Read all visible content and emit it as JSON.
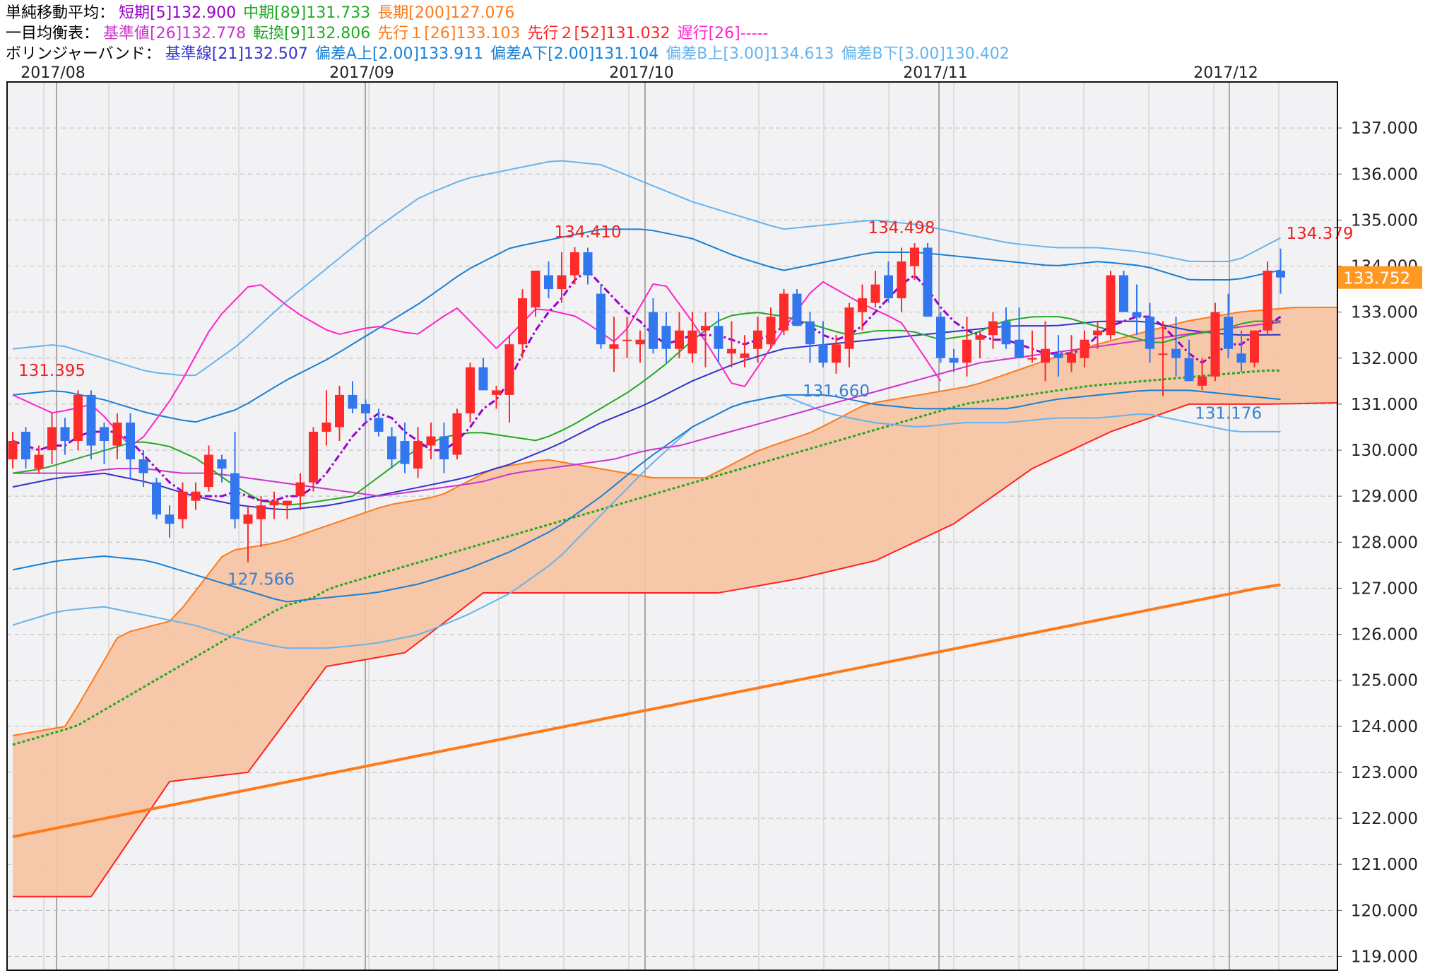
{
  "legend": {
    "sma": {
      "title": "単純移動平均：",
      "short": "短期[5]132.900",
      "mid": "中期[89]131.733",
      "long": "長期[200]127.076"
    },
    "ichimoku": {
      "title": "一目均衡表：",
      "kijun": "基準値[26]132.778",
      "tenkan": "転換[9]132.806",
      "senko1": "先行１[26]133.103",
      "senko2": "先行２[52]131.032",
      "chikou": "遅行[26]-----"
    },
    "bollinger": {
      "title": "ボリンジャーバンド：",
      "base": "基準線[21]132.507",
      "a_up": "偏差A上[2.00]133.911",
      "a_down": "偏差A下[2.00]131.104",
      "b_up": "偏差B上[3.00]134.613",
      "b_down": "偏差B下[3.00]130.402"
    }
  },
  "colors": {
    "sma_short": "#9900cc",
    "sma_mid": "#22aa22",
    "sma_long": "#ff7a1a",
    "kijun": "#cc33cc",
    "tenkan": "#22aa22",
    "senko1": "#ff7a1a",
    "senko2": "#ff2222",
    "chikou": "#ff22cc",
    "bb_base": "#3333cc",
    "bb_a": "#1a7fd4",
    "bb_b": "#66b3ee",
    "cloud": "#f6c4a4",
    "up_candle": "#ff2a2a",
    "down_candle": "#3377ee",
    "price_tag": "#ff9922"
  },
  "chart_data": {
    "type": "candlestick",
    "months": [
      "2017/08",
      "2017/09",
      "2017/10",
      "2017/11",
      "2017/12"
    ],
    "ylim": [
      118.7,
      138.0
    ],
    "y_ticks": [
      "137.000",
      "136.000",
      "135.000",
      "134.000",
      "133.000",
      "132.000",
      "131.000",
      "130.000",
      "129.000",
      "128.000",
      "127.000",
      "126.000",
      "125.000",
      "124.000",
      "123.000",
      "122.000",
      "121.000",
      "120.000",
      "119.000"
    ],
    "current_price": "133.752",
    "annotations": [
      {
        "text": "131.395",
        "value": 131.395,
        "index": 3,
        "kind": "high"
      },
      {
        "text": "127.566",
        "value": 127.566,
        "index": 19,
        "kind": "low"
      },
      {
        "text": "134.410",
        "value": 134.41,
        "index": 44,
        "kind": "high"
      },
      {
        "text": "131.660",
        "value": 131.66,
        "index": 63,
        "kind": "low"
      },
      {
        "text": "134.498",
        "value": 134.498,
        "index": 68,
        "kind": "high"
      },
      {
        "text": "131.176",
        "value": 131.176,
        "index": 93,
        "kind": "low"
      },
      {
        "text": "134.379",
        "value": 134.379,
        "index": 100,
        "kind": "high"
      }
    ],
    "candles": [
      [
        129.8,
        130.4,
        129.6,
        130.2
      ],
      [
        130.4,
        130.5,
        129.6,
        129.8
      ],
      [
        129.6,
        130.1,
        129.5,
        129.9
      ],
      [
        130.0,
        130.8,
        129.7,
        130.5
      ],
      [
        130.5,
        130.7,
        129.9,
        130.2
      ],
      [
        130.2,
        131.3,
        130.0,
        131.2
      ],
      [
        131.2,
        131.3,
        129.8,
        130.1
      ],
      [
        130.5,
        130.6,
        129.7,
        130.2
      ],
      [
        130.1,
        130.8,
        129.8,
        130.6
      ],
      [
        130.6,
        130.8,
        129.4,
        129.8
      ],
      [
        129.8,
        130.0,
        129.2,
        129.5
      ],
      [
        129.3,
        129.4,
        128.5,
        128.6
      ],
      [
        128.6,
        128.8,
        128.1,
        128.4
      ],
      [
        128.5,
        129.3,
        128.3,
        129.1
      ],
      [
        128.9,
        129.3,
        128.7,
        129.1
      ],
      [
        129.2,
        130.1,
        129.1,
        129.9
      ],
      [
        129.8,
        129.9,
        129.3,
        129.6
      ],
      [
        129.5,
        130.4,
        128.3,
        128.5
      ],
      [
        128.4,
        128.8,
        127.566,
        128.6
      ],
      [
        128.5,
        129.0,
        127.9,
        128.8
      ],
      [
        128.8,
        129.1,
        128.5,
        128.9
      ],
      [
        128.8,
        128.9,
        128.5,
        128.9
      ],
      [
        129.0,
        129.5,
        128.7,
        129.3
      ],
      [
        129.3,
        130.5,
        129.1,
        130.4
      ],
      [
        130.4,
        131.3,
        130.1,
        130.6
      ],
      [
        130.5,
        131.4,
        130.2,
        131.2
      ],
      [
        131.2,
        131.5,
        130.8,
        130.9
      ],
      [
        131.0,
        131.1,
        130.6,
        130.8
      ],
      [
        130.7,
        130.9,
        130.3,
        130.4
      ],
      [
        130.3,
        130.5,
        129.6,
        129.8
      ],
      [
        130.2,
        130.6,
        129.5,
        129.7
      ],
      [
        129.6,
        130.5,
        129.4,
        130.2
      ],
      [
        130.1,
        130.6,
        129.8,
        130.3
      ],
      [
        130.3,
        130.6,
        129.5,
        129.8
      ],
      [
        129.9,
        130.9,
        129.8,
        130.8
      ],
      [
        130.8,
        131.9,
        130.6,
        131.8
      ],
      [
        131.8,
        132.0,
        131.3,
        131.3
      ],
      [
        131.2,
        131.4,
        130.9,
        131.3
      ],
      [
        131.2,
        132.5,
        130.6,
        132.3
      ],
      [
        132.3,
        133.5,
        132.0,
        133.3
      ],
      [
        133.1,
        133.9,
        132.9,
        133.9
      ],
      [
        133.8,
        134.1,
        133.3,
        133.5
      ],
      [
        133.5,
        134.3,
        133.2,
        133.8
      ],
      [
        133.8,
        134.41,
        133.6,
        134.3
      ],
      [
        134.3,
        134.4,
        133.6,
        133.8
      ],
      [
        133.4,
        133.6,
        132.2,
        132.3
      ],
      [
        132.2,
        132.9,
        131.7,
        132.3
      ],
      [
        132.4,
        132.9,
        132.0,
        132.4
      ],
      [
        132.3,
        132.6,
        131.9,
        132.4
      ],
      [
        133.0,
        133.3,
        132.1,
        132.2
      ],
      [
        132.7,
        133.0,
        131.9,
        132.2
      ],
      [
        132.2,
        133.0,
        132.0,
        132.6
      ],
      [
        132.1,
        133.0,
        131.9,
        132.6
      ],
      [
        132.6,
        133.0,
        131.8,
        132.7
      ],
      [
        132.7,
        133.0,
        131.9,
        132.2
      ],
      [
        132.1,
        132.8,
        131.8,
        132.2
      ],
      [
        132.0,
        132.5,
        131.8,
        132.1
      ],
      [
        132.2,
        132.9,
        131.9,
        132.6
      ],
      [
        132.3,
        133.1,
        132.2,
        132.9
      ],
      [
        132.6,
        133.5,
        132.5,
        133.4
      ],
      [
        133.4,
        133.5,
        132.7,
        132.7
      ],
      [
        132.8,
        133.0,
        131.9,
        132.3
      ],
      [
        132.3,
        132.8,
        131.8,
        131.9
      ],
      [
        131.9,
        132.5,
        131.66,
        132.3
      ],
      [
        132.2,
        133.2,
        131.8,
        133.1
      ],
      [
        133.0,
        133.6,
        132.6,
        133.3
      ],
      [
        133.2,
        133.9,
        133.1,
        133.6
      ],
      [
        133.8,
        134.1,
        133.2,
        133.3
      ],
      [
        133.3,
        134.4,
        133.0,
        134.1
      ],
      [
        134.0,
        134.498,
        133.7,
        134.4
      ],
      [
        134.4,
        134.5,
        132.9,
        132.9
      ],
      [
        132.9,
        133.0,
        131.9,
        132.0
      ],
      [
        132.0,
        132.2,
        131.7,
        131.9
      ],
      [
        131.9,
        132.9,
        131.6,
        132.4
      ],
      [
        132.4,
        132.6,
        132.0,
        132.5
      ],
      [
        132.5,
        133.0,
        132.2,
        132.8
      ],
      [
        132.8,
        133.1,
        132.2,
        132.3
      ],
      [
        132.4,
        133.1,
        132.1,
        132.0
      ],
      [
        132.0,
        132.6,
        131.9,
        132.0
      ],
      [
        131.9,
        132.8,
        131.5,
        132.2
      ],
      [
        132.1,
        132.5,
        131.6,
        132.0
      ],
      [
        131.9,
        132.5,
        131.7,
        132.1
      ],
      [
        132.0,
        132.6,
        131.8,
        132.4
      ],
      [
        132.5,
        132.8,
        132.2,
        132.6
      ],
      [
        132.5,
        133.9,
        132.4,
        133.8
      ],
      [
        133.8,
        133.9,
        133.0,
        133.0
      ],
      [
        133.0,
        133.6,
        132.5,
        132.9
      ],
      [
        132.9,
        133.2,
        131.9,
        132.2
      ],
      [
        132.1,
        132.8,
        131.176,
        132.1
      ],
      [
        132.2,
        132.9,
        131.6,
        132.0
      ],
      [
        132.0,
        132.4,
        131.5,
        131.5
      ],
      [
        131.4,
        132.0,
        131.3,
        131.6
      ],
      [
        131.6,
        133.2,
        131.5,
        133.0
      ],
      [
        132.9,
        133.4,
        132.0,
        132.2
      ],
      [
        132.1,
        132.6,
        131.7,
        131.9
      ],
      [
        131.9,
        132.6,
        131.8,
        132.6
      ],
      [
        132.6,
        134.1,
        132.5,
        133.9
      ],
      [
        133.9,
        134.379,
        133.4,
        133.752
      ]
    ],
    "series": {
      "sma_short": [
        130.2,
        130.1,
        130.0,
        130.1,
        130.1,
        130.3,
        130.4,
        130.4,
        130.4,
        130.2,
        129.9,
        129.6,
        129.3,
        129.1,
        129.0,
        129.0,
        129.0,
        129.1,
        129.0,
        128.9,
        128.9,
        129.0,
        129.0,
        129.2,
        129.5,
        129.9,
        130.3,
        130.6,
        130.8,
        130.7,
        130.4,
        130.2,
        130.0,
        130.0,
        130.2,
        130.5,
        130.9,
        131.1,
        131.5,
        132.1,
        132.6,
        133.0,
        133.3,
        133.7,
        133.9,
        133.6,
        133.3,
        133.0,
        132.8,
        132.5,
        132.3,
        132.4,
        132.5,
        132.5,
        132.5,
        132.4,
        132.3,
        132.4,
        132.5,
        132.7,
        132.8,
        132.7,
        132.5,
        132.4,
        132.5,
        132.7,
        133.0,
        133.3,
        133.6,
        133.8,
        133.5,
        133.1,
        132.8,
        132.6,
        132.5,
        132.4,
        132.4,
        132.3,
        132.2,
        132.1,
        132.1,
        132.1,
        132.2,
        132.5,
        132.7,
        132.8,
        132.9,
        132.9,
        132.7,
        132.4,
        132.1,
        131.9,
        132.1,
        132.3,
        132.3,
        132.5,
        132.7,
        132.9
      ],
      "sma_mid": [
        123.6,
        123.7,
        123.8,
        123.9,
        124.0,
        124.2,
        124.4,
        124.6,
        124.8,
        125.0,
        125.2,
        125.4,
        125.6,
        125.8,
        126.0,
        126.2,
        126.4,
        126.6,
        126.7,
        126.8,
        127.0,
        127.1,
        127.2,
        127.3,
        127.4,
        127.5,
        127.6,
        127.7,
        127.8,
        127.9,
        128.0,
        128.1,
        128.2,
        128.3,
        128.4,
        128.5,
        128.6,
        128.7,
        128.8,
        128.9,
        129.0,
        129.1,
        129.2,
        129.3,
        129.4,
        129.5,
        129.6,
        129.7,
        129.8,
        129.9,
        130.0,
        130.1,
        130.2,
        130.3,
        130.4,
        130.5,
        130.6,
        130.7,
        130.8,
        130.9,
        131.0,
        131.05,
        131.1,
        131.15,
        131.2,
        131.25,
        131.3,
        131.35,
        131.4,
        131.43,
        131.46,
        131.49,
        131.52,
        131.55,
        131.58,
        131.61,
        131.64,
        131.67,
        131.7,
        131.73,
        131.73
      ],
      "sma_long": [
        121.6,
        121.7,
        121.8,
        121.9,
        122.0,
        122.1,
        122.2,
        122.3,
        122.4,
        122.5,
        122.6,
        122.7,
        122.8,
        122.9,
        123.0,
        123.1,
        123.2,
        123.3,
        123.4,
        123.5,
        123.6,
        123.7,
        123.8,
        123.9,
        124.0,
        124.1,
        124.2,
        124.3,
        124.4,
        124.5,
        124.6,
        124.7,
        124.8,
        124.9,
        125.0,
        125.1,
        125.2,
        125.3,
        125.4,
        125.5,
        125.6,
        125.7,
        125.8,
        125.9,
        126.0,
        126.1,
        126.2,
        126.3,
        126.4,
        126.5,
        126.6,
        126.7,
        126.8,
        126.9,
        127.0,
        127.076
      ],
      "kijun": [
        129.5,
        129.5,
        129.5,
        129.6,
        129.6,
        129.5,
        129.5,
        129.4,
        129.3,
        129.2,
        129.1,
        129.0,
        129.1,
        129.2,
        129.3,
        129.5,
        129.6,
        129.7,
        129.8,
        130.0,
        130.1,
        130.3,
        130.5,
        130.7,
        130.9,
        131.1,
        131.3,
        131.5,
        131.7,
        131.9,
        132.0,
        132.1,
        132.2,
        132.3,
        132.4,
        132.5,
        132.6,
        132.7,
        132.778
      ],
      "tenkan": [
        129.5,
        129.6,
        129.8,
        130.0,
        130.2,
        130.1,
        129.8,
        129.3,
        128.9,
        128.8,
        128.9,
        129.0,
        129.5,
        130.0,
        130.3,
        130.4,
        130.3,
        130.2,
        130.5,
        130.9,
        131.3,
        131.8,
        132.4,
        132.9,
        133.0,
        132.9,
        132.7,
        132.5,
        132.6,
        132.6,
        132.4,
        132.5,
        132.8,
        132.9,
        132.9,
        132.7,
        132.5,
        132.3,
        132.5,
        132.6,
        132.8,
        132.806
      ],
      "senko1": [
        123.8,
        124.0,
        126.0,
        126.3,
        127.8,
        128.0,
        128.4,
        128.8,
        129.0,
        129.6,
        129.8,
        129.6,
        129.4,
        129.4,
        130.0,
        130.4,
        131.0,
        131.2,
        131.4,
        131.8,
        132.2,
        132.5,
        132.8,
        133.0,
        133.1,
        133.103
      ],
      "senko2": [
        120.3,
        120.3,
        122.8,
        123.0,
        125.3,
        125.6,
        126.9,
        126.9,
        126.9,
        126.9,
        127.2,
        127.6,
        128.4,
        129.6,
        130.4,
        131.0,
        131.0,
        131.032
      ],
      "chikou": [
        131.2,
        130.8,
        131.0,
        130.0,
        131.2,
        132.8,
        133.7,
        133.0,
        132.5,
        132.7,
        132.5,
        133.1,
        132.2,
        133.1,
        132.9,
        132.3,
        133.8,
        132.6,
        131.2,
        132.5,
        133.7,
        133.2,
        132.8,
        131.5
      ],
      "bb_base": [
        129.2,
        129.4,
        129.5,
        129.3,
        129.0,
        128.8,
        128.7,
        128.8,
        129.0,
        129.2,
        129.4,
        129.7,
        130.1,
        130.6,
        131.0,
        131.5,
        131.9,
        132.2,
        132.3,
        132.4,
        132.5,
        132.6,
        132.7,
        132.7,
        132.8,
        132.8,
        132.6,
        132.5,
        132.507
      ],
      "bb_a_up": [
        131.2,
        131.3,
        131.1,
        130.8,
        130.6,
        130.9,
        131.5,
        132.0,
        132.6,
        133.2,
        133.9,
        134.4,
        134.6,
        134.8,
        134.8,
        134.6,
        134.2,
        133.9,
        134.1,
        134.3,
        134.3,
        134.2,
        134.1,
        134.0,
        134.1,
        134.0,
        133.7,
        133.7,
        133.911
      ],
      "bb_a_down": [
        127.4,
        127.6,
        127.7,
        127.6,
        127.3,
        127.0,
        126.7,
        126.8,
        126.9,
        127.1,
        127.4,
        127.8,
        128.3,
        129.0,
        129.8,
        130.5,
        131.0,
        131.2,
        131.2,
        131.0,
        130.9,
        130.9,
        130.9,
        131.1,
        131.2,
        131.3,
        131.3,
        131.2,
        131.104
      ],
      "bb_b_up": [
        132.2,
        132.3,
        132.0,
        131.7,
        131.6,
        132.3,
        133.2,
        134.0,
        134.8,
        135.5,
        135.9,
        136.1,
        136.3,
        136.2,
        135.8,
        135.4,
        135.1,
        134.8,
        134.9,
        135.0,
        134.9,
        134.7,
        134.5,
        134.4,
        134.4,
        134.3,
        134.1,
        134.1,
        134.613
      ],
      "bb_b_down": [
        126.2,
        126.5,
        126.6,
        126.4,
        126.2,
        125.9,
        125.7,
        125.7,
        125.8,
        126.0,
        126.4,
        126.9,
        127.6,
        128.6,
        129.6,
        130.5,
        131.0,
        131.2,
        130.8,
        130.6,
        130.5,
        130.6,
        130.6,
        130.7,
        130.7,
        130.8,
        130.6,
        130.4,
        130.402
      ]
    }
  }
}
